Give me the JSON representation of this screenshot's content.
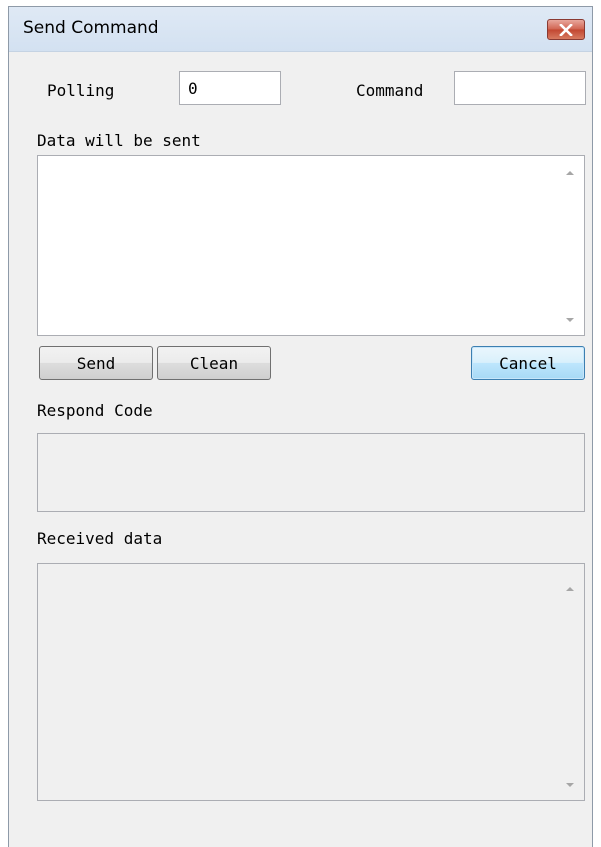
{
  "window": {
    "title": "Send Command"
  },
  "form": {
    "polling_label": "Polling",
    "polling_value": "0",
    "command_label": "Command",
    "command_value": "",
    "data_label": "Data will be sent",
    "data_value": "",
    "respond_label": "Respond Code",
    "respond_value": "",
    "received_label": "Received data",
    "received_value": ""
  },
  "buttons": {
    "send": "Send",
    "clean": "Clean",
    "cancel": "Cancel"
  },
  "icons": {
    "close": "close-icon",
    "scroll_up": "scroll-up-arrow-icon",
    "scroll_down": "scroll-down-arrow-icon"
  },
  "colors": {
    "close_button": "#c24630",
    "default_button_border": "#3c7fb1",
    "window_background": "#f0f0f0",
    "title_bar": "#d3e1f1"
  }
}
